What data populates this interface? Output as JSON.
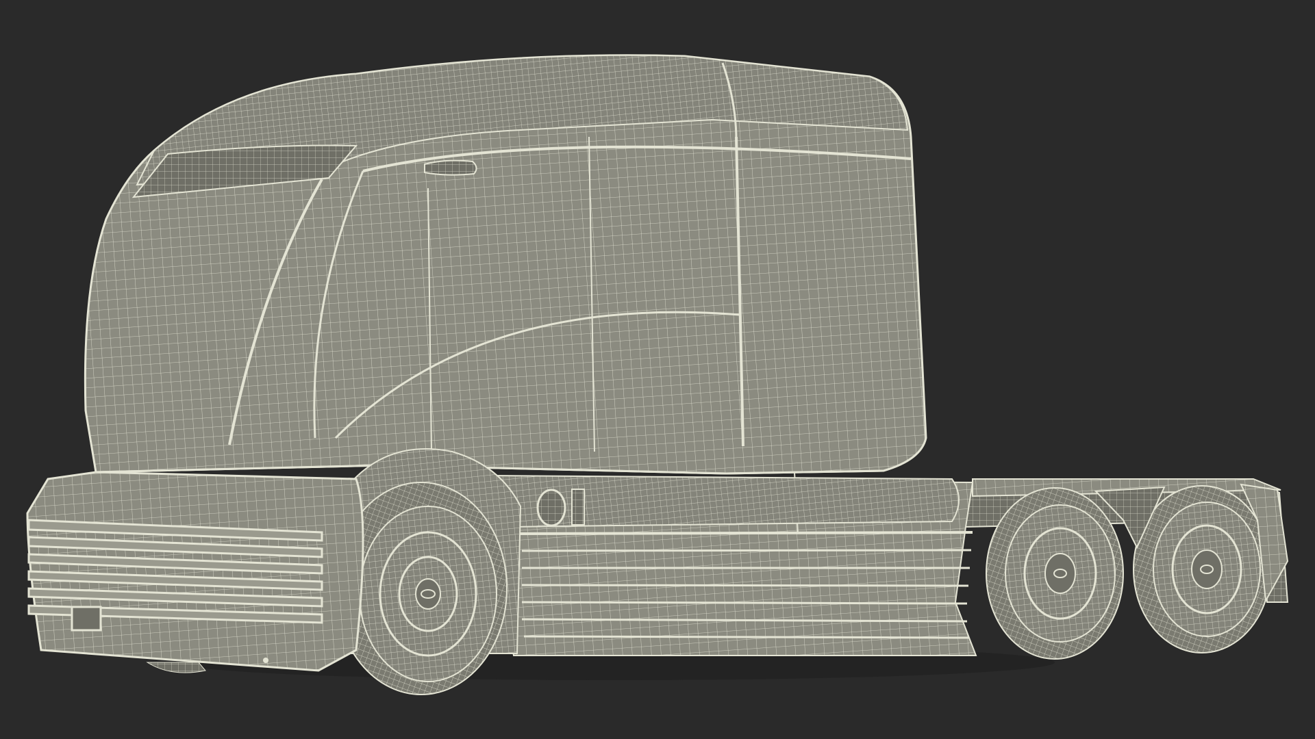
{
  "scene": {
    "background_color": "#2a2a2a",
    "mesh_fill_color": "#8b8b80",
    "mesh_shade_color": "#6f6f66",
    "wire_color": "#e4e4d4",
    "subject": "truck-tractor-wireframe"
  }
}
